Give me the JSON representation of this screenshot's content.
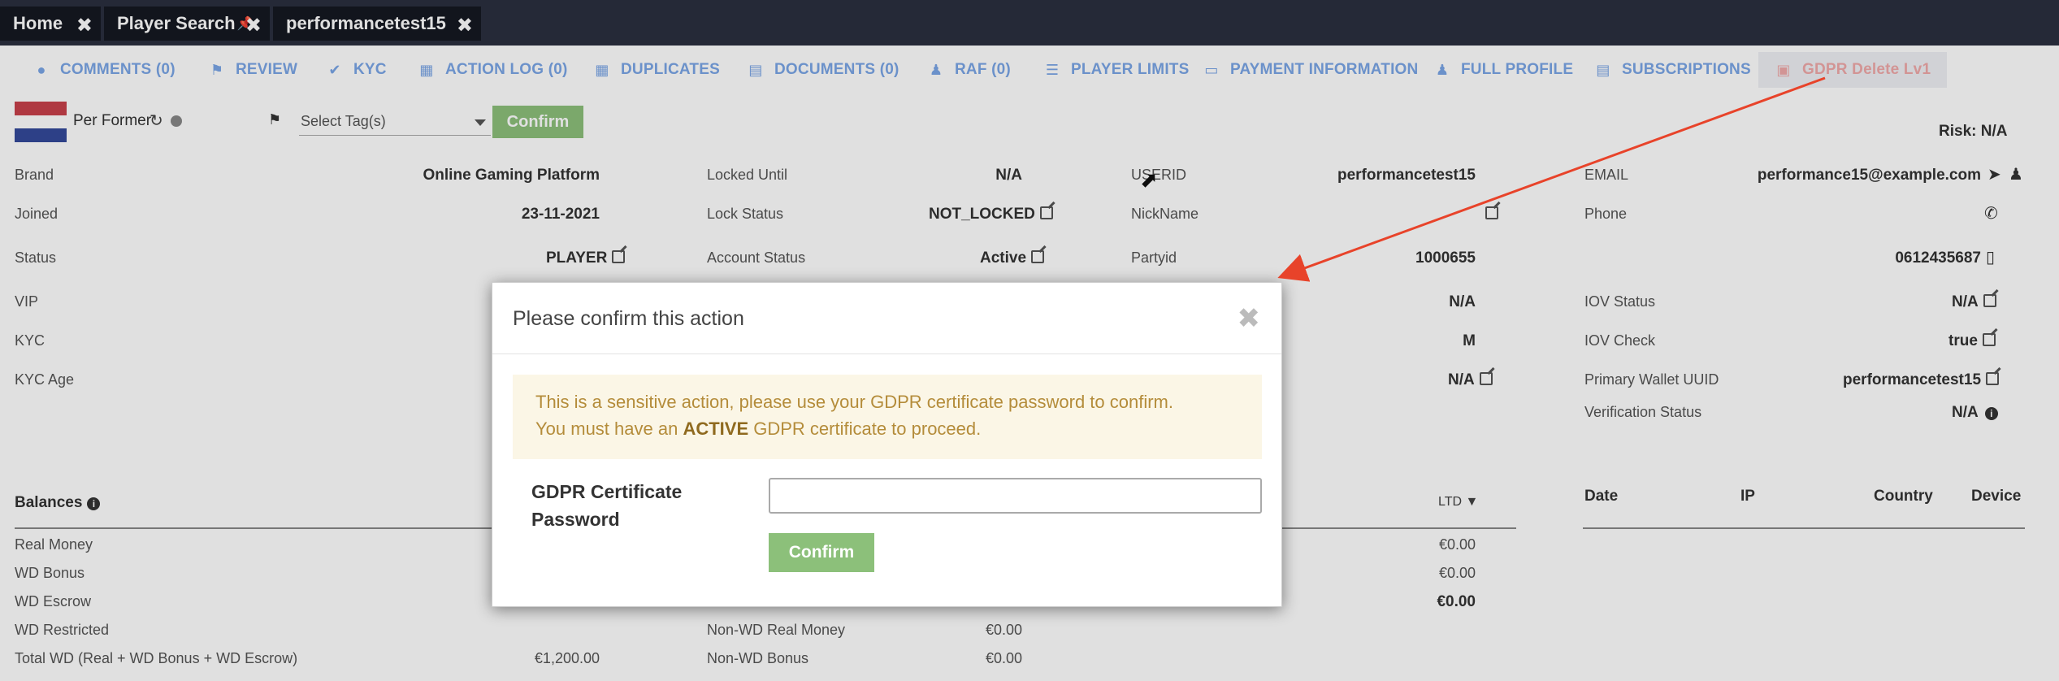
{
  "top_tabs": [
    {
      "label": "Home"
    },
    {
      "label": "Player Search"
    },
    {
      "label": "performancetest15"
    }
  ],
  "close_glyph": "✖",
  "nav_tabs": [
    {
      "label": "COMMENTS (0)",
      "icon": "comment-icon"
    },
    {
      "label": "REVIEW",
      "icon": "flag-icon"
    },
    {
      "label": "KYC",
      "icon": "check-circle-icon"
    },
    {
      "label": "ACTION LOG (0)",
      "icon": "map-icon"
    },
    {
      "label": "DUPLICATES",
      "icon": "grid-icon"
    },
    {
      "label": "DOCUMENTS (0)",
      "icon": "folder-icon"
    },
    {
      "label": "RAF (0)",
      "icon": "users-icon"
    },
    {
      "label": "PLAYER LIMITS",
      "icon": "list-icon"
    },
    {
      "label": "PAYMENT INFORMATION",
      "icon": "credit-card-icon"
    },
    {
      "label": "FULL PROFILE",
      "icon": "user-icon"
    },
    {
      "label": "SUBSCRIPTIONS",
      "icon": "file-icon"
    },
    {
      "label": "GDPR Delete Lv1",
      "icon": "trash-icon"
    }
  ],
  "header": {
    "player_name": "Per Former",
    "tag_placeholder": "Select Tag(s)",
    "confirm_label": "Confirm",
    "risk": "Risk: N/A"
  },
  "profile": {
    "col1": [
      {
        "label": "Brand",
        "value": "Online Gaming Platform"
      },
      {
        "label": "Joined",
        "value": "23-11-2021"
      },
      {
        "label": "Status",
        "value": "PLAYER"
      },
      {
        "label": "VIP",
        "value": ""
      },
      {
        "label": "KYC",
        "value": ""
      },
      {
        "label": "KYC Age",
        "value": ""
      }
    ],
    "col2": [
      {
        "label": "Locked Until",
        "value": "N/A"
      },
      {
        "label": "Lock Status",
        "value": "NOT_LOCKED"
      },
      {
        "label": "Account Status",
        "value": "Active"
      }
    ],
    "col3": [
      {
        "label": "USERID",
        "value": "performancetest15"
      },
      {
        "label": "NickName",
        "value": ""
      },
      {
        "label": "Partyid",
        "value": "1000655"
      }
    ],
    "col3_extra": [
      "N/A",
      "M",
      "N/A"
    ],
    "col4": [
      {
        "label": "EMAIL",
        "value": "performance15@example.com"
      },
      {
        "label": "Phone",
        "value": ""
      },
      {
        "label": "",
        "value": "0612435687"
      },
      {
        "label": "IOV Status",
        "value": "N/A"
      },
      {
        "label": "IOV Check",
        "value": "true"
      },
      {
        "label": "Primary Wallet UUID",
        "value": "performancetest15"
      },
      {
        "label": "Verification Status",
        "value": "N/A"
      }
    ]
  },
  "balances": {
    "title": "Balances",
    "period": "LTD",
    "rows": [
      {
        "label": "Real Money",
        "value": ""
      },
      {
        "label": "WD Bonus",
        "value": ""
      },
      {
        "label": "WD Escrow",
        "value": ""
      },
      {
        "label": "WD Restricted",
        "value": ""
      },
      {
        "label": "Total WD (Real + WD Bonus + WD Escrow)",
        "value": "€1,200.00"
      }
    ],
    "mid_rows": [
      {
        "label": "Non-WD Real Money",
        "value": "€0.00"
      },
      {
        "label": "Non-WD Bonus",
        "value": "€0.00"
      }
    ],
    "ltd_values": [
      "€0.00",
      "€0.00",
      "€0.00"
    ]
  },
  "sessions": {
    "headers": [
      "Date",
      "IP",
      "Country",
      "Device"
    ]
  },
  "modal": {
    "title": "Please confirm this action",
    "close": "✖",
    "warning_line1": "This is a sensitive action, please use your GDPR certificate password to confirm.",
    "warning_line2_pre": "You must have an ",
    "warning_line2_bold": "ACTIVE",
    "warning_line2_post": " GDPR certificate to proceed.",
    "password_label": "GDPR Certificate Password",
    "password_value": "",
    "confirm_label": "Confirm"
  },
  "colors": {
    "topbar": "#2b2f3f",
    "tab_link": "#7aa6e6",
    "confirm_green": "#8cc07a",
    "annotation_arrow": "#e8432a",
    "flag_red": "#c8404a",
    "flag_blue": "#34499a"
  }
}
